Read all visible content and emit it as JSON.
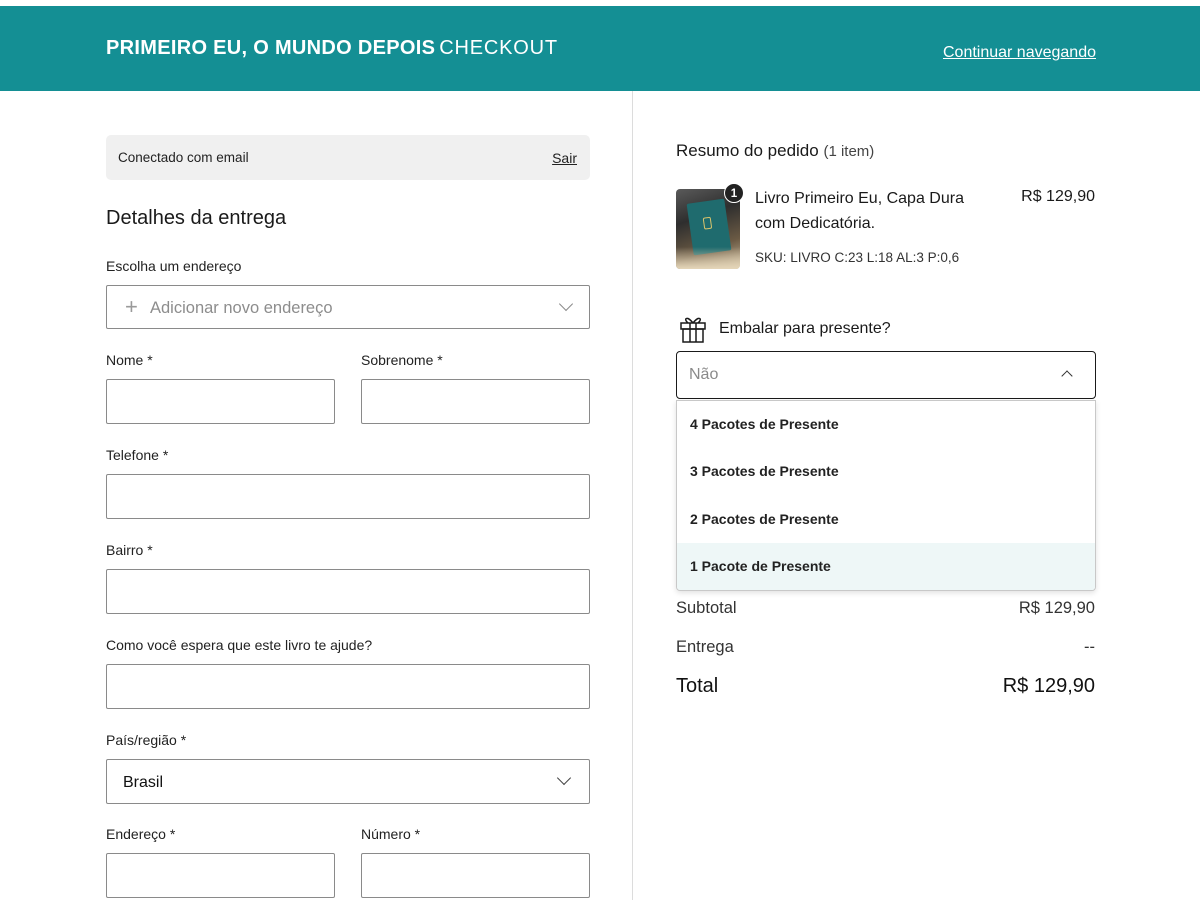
{
  "header": {
    "brand": "PRIMEIRO EU, O MUNDO DEPOIS",
    "section": "CHECKOUT",
    "continue_link": "Continuar navegando"
  },
  "login": {
    "text": "Conectado com email",
    "logout": "Sair"
  },
  "delivery": {
    "title": "Detalhes da entrega",
    "address_label": "Escolha um endereço",
    "address_placeholder": "Adicionar novo endereço",
    "first_name_label": "Nome *",
    "last_name_label": "Sobrenome *",
    "phone_label": "Telefone *",
    "district_label": "Bairro *",
    "question_label": "Como você espera que este livro te ajude?",
    "country_label": "País/região *",
    "country_value": "Brasil",
    "street_label": "Endereço *",
    "number_label": "Número *"
  },
  "summary": {
    "title": "Resumo do pedido",
    "count": "(1 item)",
    "item": {
      "name": "Livro Primeiro Eu, Capa Dura com Dedicatória.",
      "price": "R$ 129,90",
      "sku": "SKU: LIVRO C:23 L:18 AL:3 P:0,6",
      "qty_badge": "1"
    },
    "gift_label": "Embalar para presente?",
    "gift_selected": "Não",
    "gift_options": [
      "4 Pacotes de Presente",
      "3 Pacotes de Presente",
      "2 Pacotes de Presente",
      "1 Pacote de Presente"
    ],
    "subtotal_label": "Subtotal",
    "subtotal_value": "R$ 129,90",
    "delivery_label": "Entrega",
    "delivery_value": "--",
    "total_label": "Total",
    "total_value": "R$ 129,90"
  },
  "colors": {
    "header_bg": "#148f94",
    "highlight_option": "#eef7f7"
  },
  "icons": {
    "add": "plus-icon",
    "chevron": "chevron-down-icon",
    "gift": "gift-icon"
  }
}
